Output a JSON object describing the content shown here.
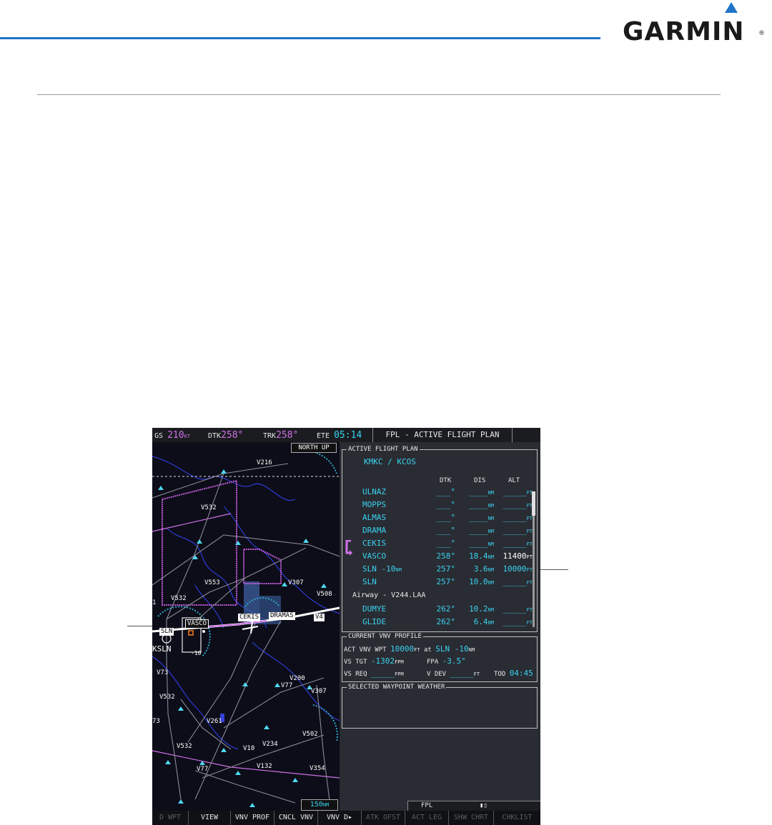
{
  "brand": {
    "logo_text": "GARMIN",
    "reg": "®",
    "colors": {
      "accent": "#1f74c8"
    }
  },
  "topbar": {
    "gs_label": "GS",
    "gs_value": "210",
    "gs_unit": "KT",
    "dtk_label": "DTK",
    "dtk_value": "258°",
    "trk_label": "TRK",
    "trk_value": "258°",
    "ete_label": "ETE",
    "ete_value": "05:14",
    "page_title": "FPL - ACTIVE FLIGHT PLAN"
  },
  "map": {
    "orientation": "NORTH UP",
    "range_value": "150",
    "range_unit": "NM",
    "labels": {
      "v216": "V216",
      "v532a": "V532",
      "v553": "V553",
      "v307a": "V307",
      "v508": "V508",
      "v532b": "V532",
      "v4": "V4",
      "v73": "V73",
      "v200": "V200",
      "v77a": "V77",
      "v307b": "V307",
      "v532c": "V532",
      "v261": "V261",
      "v502": "V502",
      "v234": "V234",
      "v10": "V10",
      "v532d": "V532",
      "v77b": "V77",
      "v132": "V132",
      "v354": "V354",
      "v73b": "73",
      "ksln": "KSLN",
      "minus10": "-10",
      "one": "1"
    },
    "boxes": {
      "cekis": "CEKIS",
      "dramas": "DRAMAS",
      "sln": "SLN",
      "vasco": "VASCO"
    }
  },
  "flight_plan": {
    "box_title": "ACTIVE FLIGHT PLAN",
    "route": "KMKC / KCOS",
    "headers": {
      "dtk": "DTK",
      "dis": "DIS",
      "alt": "ALT"
    },
    "rows": [
      {
        "wp": "ULNAZ",
        "dtk": "___°",
        "dis": "____",
        "dis_unit": "NM",
        "alt": "_____",
        "alt_unit": "FT"
      },
      {
        "wp": "MOPPS",
        "dtk": "___°",
        "dis": "____",
        "dis_unit": "NM",
        "alt": "_____",
        "alt_unit": "FT"
      },
      {
        "wp": "ALMAS",
        "dtk": "___°",
        "dis": "____",
        "dis_unit": "NM",
        "alt": "_____",
        "alt_unit": "FT"
      },
      {
        "wp": "DRAMA",
        "dtk": "___°",
        "dis": "____",
        "dis_unit": "NM",
        "alt": "_____",
        "alt_unit": "FT"
      },
      {
        "wp": "CEKIS",
        "dtk": "___°",
        "dis": "____",
        "dis_unit": "NM",
        "alt": "_____",
        "alt_unit": "FT"
      },
      {
        "wp": "VASCO",
        "dtk": "258°",
        "dis": "18.4",
        "dis_unit": "NM",
        "alt": "11400",
        "alt_unit": "FT"
      },
      {
        "wp": "SLN -10",
        "wp_unit": "NM",
        "dtk": "257°",
        "dis": "3.6",
        "dis_unit": "NM",
        "alt": "10000",
        "alt_unit": "FT"
      },
      {
        "wp": "SLN",
        "dtk": "257°",
        "dis": "10.0",
        "dis_unit": "NM",
        "alt": "_____",
        "alt_unit": "FT"
      },
      {
        "wp": "DUMYE",
        "dtk": "262°",
        "dis": "10.2",
        "dis_unit": "NM",
        "alt": "_____",
        "alt_unit": "FT"
      },
      {
        "wp": "GLIDE",
        "dtk": "262°",
        "dis": "6.4",
        "dis_unit": "NM",
        "alt": "_____",
        "alt_unit": "FT"
      }
    ],
    "airway": "Airway - V244.LAA"
  },
  "vnv_profile": {
    "box_title": "CURRENT VNV PROFILE",
    "act_label": "ACT VNV WPT",
    "act_alt": "10000",
    "act_alt_unit": "FT",
    "act_at": "at",
    "act_wp": "SLN -10",
    "act_wp_unit": "NM",
    "vs_tgt_label": "VS TGT",
    "vs_tgt_value": "-1302",
    "vs_tgt_unit": "FPM",
    "fpa_label": "FPA",
    "fpa_value": "-3.5°",
    "vs_req_label": "VS REQ",
    "vs_req_value": "_____",
    "vs_req_unit": "FPM",
    "vdev_label": "V DEV",
    "vdev_value": "_____",
    "vdev_unit": "FT",
    "tod_label": "TOD",
    "tod_value": "04:45"
  },
  "weather": {
    "box_title": "SELECTED WAYPOINT WEATHER"
  },
  "page_group": {
    "label": "FPL",
    "pages": "▮▯"
  },
  "softkeys": [
    {
      "label": "D WPT",
      "active": false
    },
    {
      "label": "VIEW",
      "active": true
    },
    {
      "label": "VNV PROF",
      "active": true
    },
    {
      "label": "CNCL VNV",
      "active": true
    },
    {
      "label": "VNV D▸",
      "active": true
    },
    {
      "label": "ATK OFST",
      "active": false
    },
    {
      "label": "ACT LEG",
      "active": false
    },
    {
      "label": "SHW CHRT",
      "active": false
    },
    {
      "label": "CHKLIST",
      "active": false
    }
  ]
}
